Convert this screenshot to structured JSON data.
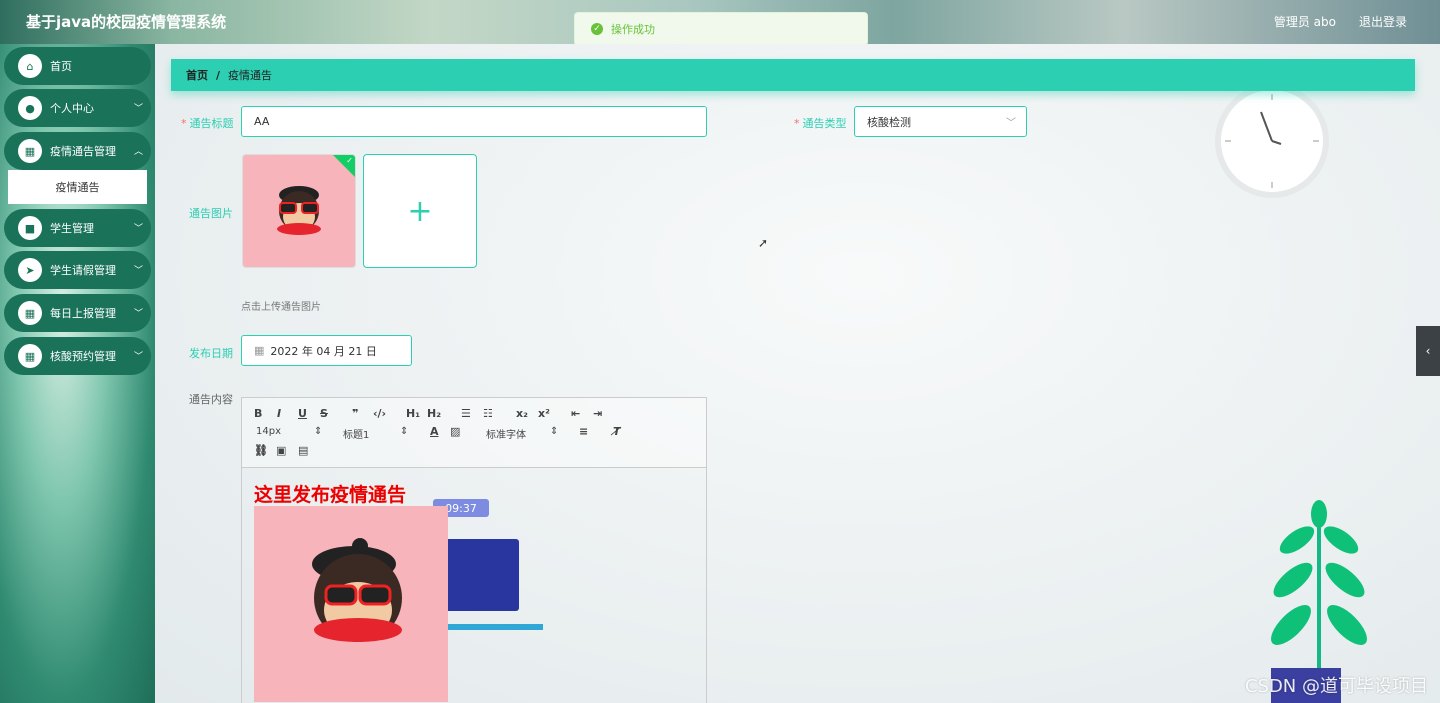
{
  "header": {
    "brand": "基于java的校园疫情管理系统",
    "user": "管理员 abo",
    "logout": "退出登录"
  },
  "toast": {
    "message": "操作成功"
  },
  "sidebar": {
    "items": [
      {
        "label": "首页",
        "icon": "home-icon"
      },
      {
        "label": "个人中心",
        "icon": "user-icon"
      },
      {
        "label": "疫情通告管理",
        "icon": "grid-icon"
      },
      {
        "label": "学生管理",
        "icon": "folder-icon"
      },
      {
        "label": "学生请假管理",
        "icon": "send-icon"
      },
      {
        "label": "每日上报管理",
        "icon": "grid-icon"
      },
      {
        "label": "核酸预约管理",
        "icon": "grid-icon"
      }
    ],
    "submenu": "疫情通告"
  },
  "breadcrumb": {
    "home": "首页",
    "sep": "/",
    "current": "疫情通告"
  },
  "form": {
    "title_label": "通告标题",
    "title_value": "AA",
    "type_label": "通告类型",
    "type_value": "核酸检测",
    "image_label": "通告图片",
    "image_hint": "点击上传通告图片",
    "date_label": "发布日期",
    "date_value": "2022 年 04 月 21 日",
    "content_label": "通告内容"
  },
  "editor": {
    "font_size": "14px",
    "heading": "标题1",
    "font_family": "标准字体",
    "content_title": "这里发布疫情通告"
  },
  "misc": {
    "time_badge": "09:37",
    "watermark": "CSDN @道可毕设项目"
  },
  "colors": {
    "accent": "#2ccfb2",
    "sidebar_item": "#1a7259",
    "required": "#f56c6c",
    "success": "#67c23a"
  }
}
